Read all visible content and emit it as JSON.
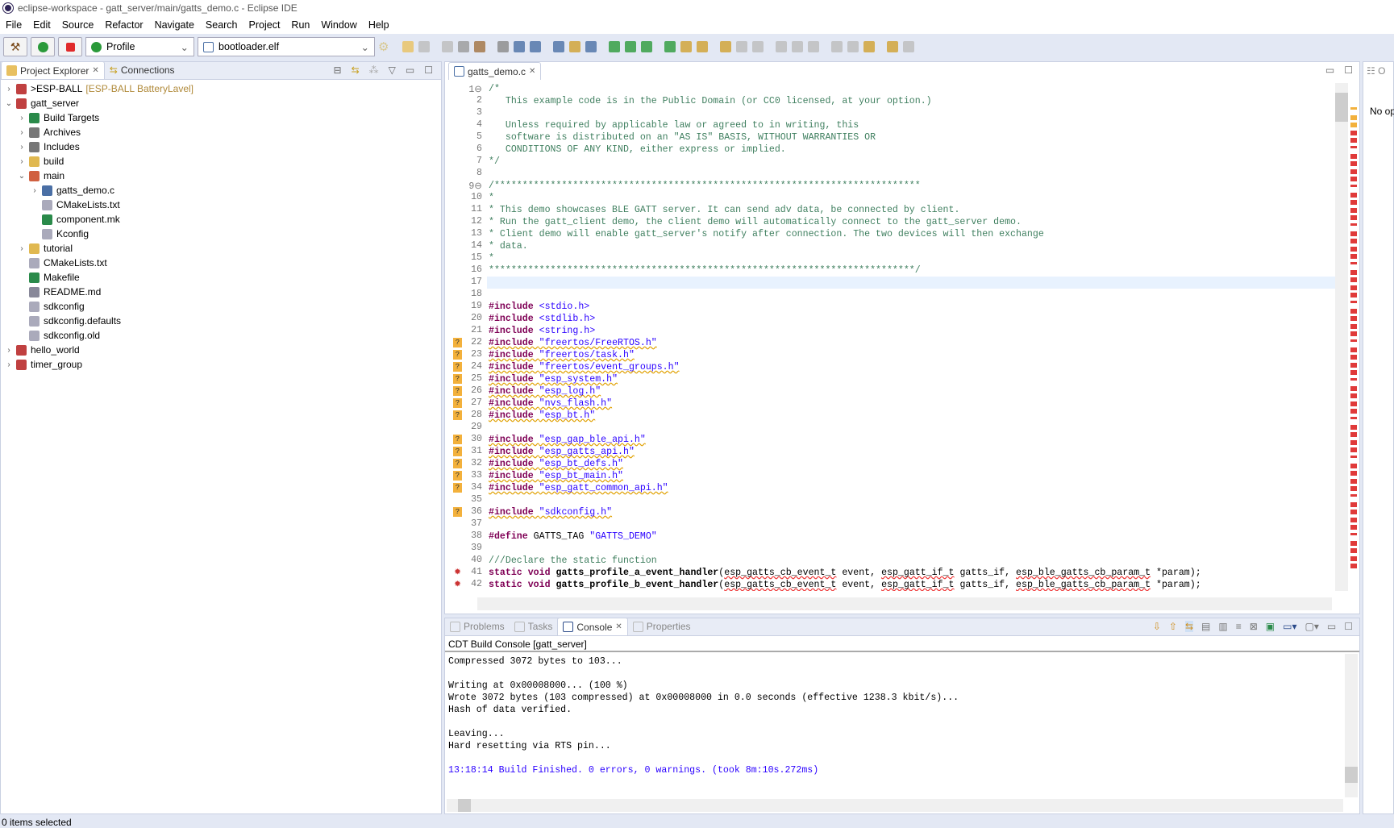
{
  "window": {
    "title": "eclipse-workspace - gatt_server/main/gatts_demo.c - Eclipse IDE"
  },
  "menu": [
    "File",
    "Edit",
    "Source",
    "Refactor",
    "Navigate",
    "Search",
    "Project",
    "Run",
    "Window",
    "Help"
  ],
  "toolbar": {
    "launch_mode": "Profile",
    "launch_target": "bootloader.elf",
    "icons": [
      "build-icon",
      "run-icon",
      "stop-icon"
    ]
  },
  "explorer": {
    "tabs": [
      {
        "label": "Project Explorer",
        "active": true
      },
      {
        "label": "Connections",
        "active": false
      }
    ],
    "tree": [
      {
        "label": "ESP-BALL",
        "prefix": "> ",
        "decoration": "[ESP-BALL BatteryLavel]",
        "level": 0,
        "twisty": "closed",
        "icon": "project"
      },
      {
        "label": "gatt_server",
        "level": 0,
        "twisty": "open",
        "icon": "project"
      },
      {
        "label": "Build Targets",
        "level": 1,
        "twisty": "closed",
        "icon": "target"
      },
      {
        "label": "Archives",
        "level": 1,
        "twisty": "closed",
        "icon": "archive"
      },
      {
        "label": "Includes",
        "level": 1,
        "twisty": "closed",
        "icon": "includes"
      },
      {
        "label": "build",
        "level": 1,
        "twisty": "closed",
        "icon": "folder"
      },
      {
        "label": "main",
        "level": 1,
        "twisty": "open",
        "icon": "folder-src"
      },
      {
        "label": "gatts_demo.c",
        "level": 2,
        "twisty": "closed",
        "icon": "c-file"
      },
      {
        "label": "CMakeLists.txt",
        "level": 2,
        "twisty": "",
        "icon": "file"
      },
      {
        "label": "component.mk",
        "level": 2,
        "twisty": "",
        "icon": "make-file"
      },
      {
        "label": "Kconfig",
        "level": 2,
        "twisty": "",
        "icon": "file"
      },
      {
        "label": "tutorial",
        "level": 1,
        "twisty": "closed",
        "icon": "folder"
      },
      {
        "label": "CMakeLists.txt",
        "level": 1,
        "twisty": "",
        "icon": "file"
      },
      {
        "label": "Makefile",
        "level": 1,
        "twisty": "",
        "icon": "make-file"
      },
      {
        "label": "README.md",
        "level": 1,
        "twisty": "",
        "icon": "md-file"
      },
      {
        "label": "sdkconfig",
        "level": 1,
        "twisty": "",
        "icon": "file"
      },
      {
        "label": "sdkconfig.defaults",
        "level": 1,
        "twisty": "",
        "icon": "file"
      },
      {
        "label": "sdkconfig.old",
        "level": 1,
        "twisty": "",
        "icon": "file"
      },
      {
        "label": "hello_world",
        "level": 0,
        "twisty": "closed",
        "icon": "project"
      },
      {
        "label": "timer_group",
        "level": 0,
        "twisty": "closed",
        "icon": "project"
      }
    ]
  },
  "editor": {
    "tab": "gatts_demo.c",
    "current_line": 17,
    "lines": [
      [
        [
          "cm",
          "/*"
        ]
      ],
      [
        [
          "cm",
          "   This example code is in the Public Domain (or CC0 licensed, at your option.)"
        ]
      ],
      [],
      [
        [
          "cm",
          "   Unless required by applicable law or agreed to in writing, this"
        ]
      ],
      [
        [
          "cm",
          "   software is distributed on an \"AS IS\" BASIS, WITHOUT WARRANTIES OR"
        ]
      ],
      [
        [
          "cm",
          "   CONDITIONS OF ANY KIND, either express or implied."
        ]
      ],
      [
        [
          "cm",
          "*/"
        ]
      ],
      [],
      [
        [
          "cm",
          "/****************************************************************************"
        ]
      ],
      [
        [
          "cm",
          "*"
        ]
      ],
      [
        [
          "cm",
          "* This demo showcases BLE GATT server. It can send adv data, be connected by client."
        ]
      ],
      [
        [
          "cm",
          "* Run the gatt_client demo, the client demo will automatically connect to the gatt_server demo."
        ]
      ],
      [
        [
          "cm",
          "* Client demo will enable gatt_server's notify after connection. The two devices will then exchange"
        ]
      ],
      [
        [
          "cm",
          "* data."
        ]
      ],
      [
        [
          "cm",
          "*"
        ]
      ],
      [
        [
          "cm",
          "****************************************************************************/"
        ]
      ],
      [],
      [],
      [
        [
          "pp",
          "#include "
        ],
        [
          "st",
          "<stdio.h>"
        ]
      ],
      [
        [
          "pp",
          "#include "
        ],
        [
          "st",
          "<stdlib.h>"
        ]
      ],
      [
        [
          "pp",
          "#include "
        ],
        [
          "st",
          "<string.h>"
        ]
      ],
      [
        [
          "pp sqy",
          "#include "
        ],
        [
          "st sqy",
          "\"freertos/FreeRTOS.h\""
        ]
      ],
      [
        [
          "pp sqy",
          "#include "
        ],
        [
          "st sqy",
          "\"freertos/task.h\""
        ]
      ],
      [
        [
          "pp sqy",
          "#include "
        ],
        [
          "st sqy",
          "\"freertos/event_groups.h\""
        ]
      ],
      [
        [
          "pp sqy",
          "#include "
        ],
        [
          "st sqy",
          "\"esp_system.h\""
        ]
      ],
      [
        [
          "pp sqy",
          "#include "
        ],
        [
          "st sqy",
          "\"esp_log.h\""
        ]
      ],
      [
        [
          "pp sqy",
          "#include "
        ],
        [
          "st sqy",
          "\"nvs_flash.h\""
        ]
      ],
      [
        [
          "pp sqy",
          "#include "
        ],
        [
          "st sqy",
          "\"esp_bt.h\""
        ]
      ],
      [],
      [
        [
          "pp sqy",
          "#include "
        ],
        [
          "st sqy",
          "\"esp_gap_ble_api.h\""
        ]
      ],
      [
        [
          "pp sqy",
          "#include "
        ],
        [
          "st sqy",
          "\"esp_gatts_api.h\""
        ]
      ],
      [
        [
          "pp sqy",
          "#include "
        ],
        [
          "st sqy",
          "\"esp_bt_defs.h\""
        ]
      ],
      [
        [
          "pp sqy",
          "#include "
        ],
        [
          "st sqy",
          "\"esp_bt_main.h\""
        ]
      ],
      [
        [
          "pp sqy",
          "#include "
        ],
        [
          "st sqy",
          "\"esp_gatt_common_api.h\""
        ]
      ],
      [],
      [
        [
          "pp sqy",
          "#include "
        ],
        [
          "st sqy",
          "\"sdkconfig.h\""
        ]
      ],
      [],
      [
        [
          "pp",
          "#define "
        ],
        [
          "",
          "GATTS_TAG "
        ],
        [
          "st",
          "\"GATTS_DEMO\""
        ]
      ],
      [],
      [
        [
          "cm",
          "///Declare the static function"
        ]
      ],
      [
        [
          "kw",
          "static void "
        ],
        [
          "fn",
          "gatts_profile_a_event_handler"
        ],
        [
          "",
          "("
        ],
        [
          "sq",
          "esp_gatts_cb_event_t"
        ],
        [
          "",
          " event, "
        ],
        [
          "sq",
          "esp_gatt_if_t"
        ],
        [
          "",
          " gatts_if, "
        ],
        [
          "sq",
          "esp_ble_gatts_cb_param_t"
        ],
        [
          "",
          " *param);"
        ]
      ],
      [
        [
          "kw",
          "static void "
        ],
        [
          "fn",
          "gatts_profile_b_event_handler"
        ],
        [
          "",
          "("
        ],
        [
          "sq",
          "esp_gatts_cb_event_t"
        ],
        [
          "",
          " event, "
        ],
        [
          "sq",
          "esp_gatt_if_t"
        ],
        [
          "",
          " gatts_if, "
        ],
        [
          "sq",
          "esp_ble_gatts_cb_param_t"
        ],
        [
          "",
          " *param);"
        ]
      ],
      []
    ],
    "warning_lines": [
      22,
      23,
      24,
      25,
      26,
      27,
      28,
      30,
      31,
      32,
      33,
      34,
      36
    ],
    "error_lines": [
      41,
      42
    ]
  },
  "outline": {
    "message": "No op"
  },
  "bottom": {
    "tabs": [
      {
        "label": "Problems",
        "active": false
      },
      {
        "label": "Tasks",
        "active": false
      },
      {
        "label": "Console",
        "active": true
      },
      {
        "label": "Properties",
        "active": false
      }
    ],
    "console_title": "CDT Build Console [gatt_server]",
    "lines": [
      {
        "text": "Compressed 3072 bytes to 103..."
      },
      {
        "text": ""
      },
      {
        "text": "Writing at 0x00008000... (100 %)"
      },
      {
        "text": "Wrote 3072 bytes (103 compressed) at 0x00008000 in 0.0 seconds (effective 1238.3 kbit/s)..."
      },
      {
        "text": "Hash of data verified."
      },
      {
        "text": ""
      },
      {
        "text": "Leaving..."
      },
      {
        "text": "Hard resetting via RTS pin..."
      },
      {
        "text": ""
      },
      {
        "text": "13:18:14 Build Finished. 0 errors, 0 warnings. (took 8m:10s.272ms)",
        "color": "#2a00ff"
      }
    ]
  },
  "status": {
    "text": "0 items selected"
  }
}
